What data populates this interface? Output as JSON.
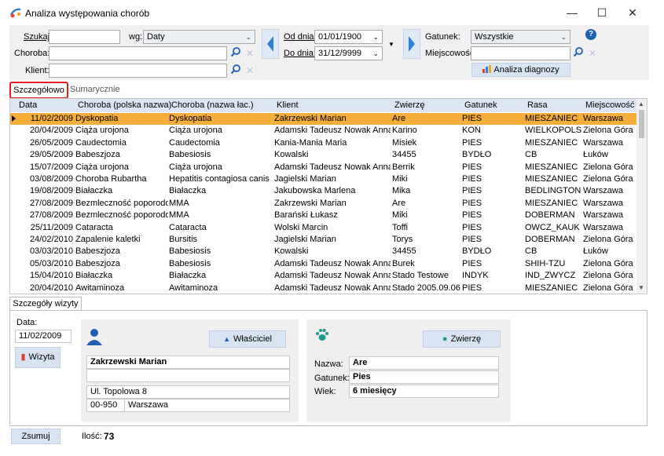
{
  "window": {
    "title": "Analiza występowania chorób",
    "minimize": "—",
    "maximize": "☐",
    "close": "✕"
  },
  "filters": {
    "szukaj_label": "Szukaj:",
    "szukaj_value": "",
    "wg_label": "wg:",
    "wg_value": "Daty",
    "choroba_label": "Choroba:",
    "klient_label": "Klient:",
    "od_label": "Od dnia:",
    "od_value": "01/01/1900",
    "do_label": "Do dnia:",
    "do_value": "31/12/9999",
    "gatunek_label": "Gatunek:",
    "gatunek_value": "Wszystkie",
    "miejscowosc_label": "Miejscowość:",
    "analiza_button": "Analiza diagnozy",
    "help": "?"
  },
  "tabs": {
    "active": "Szczegółowo",
    "inactive": "Sumarycznie"
  },
  "table": {
    "columns": [
      "Data",
      "Choroba (polska nazwa)",
      "Choroba (nazwa łac.)",
      "Klient",
      "Zwierzę",
      "Gatunek",
      "Rasa",
      "Miejscowość"
    ],
    "rows": [
      [
        "11/02/2009",
        "Dyskopatia",
        "Dyskopatia",
        "Zakrzewski Marian",
        "Are",
        "PIES",
        "MIESZANIEC",
        "Warszawa"
      ],
      [
        "20/04/2009",
        "Ciąża urojona",
        "Ciąża urojona",
        "Adamski Tadeusz Nowak Anna",
        "Karino",
        "KOŃ",
        "WIELKOPOLS",
        "Zielona Góra"
      ],
      [
        "26/05/2009",
        "Caudectomia",
        "Caudectomia",
        "Kania-Mania Maria",
        "Misiek",
        "PIES",
        "MIESZANIEC",
        "Warszawa"
      ],
      [
        "29/05/2009",
        "Babeszjoza",
        "Babesiosis",
        "Kowalski",
        "34455",
        "BYDŁO",
        "CB",
        "Łuków"
      ],
      [
        "15/07/2009",
        "Ciąża urojona",
        "Ciąża urojona",
        "Adamski Tadeusz Nowak Anna",
        "Berrik",
        "PIES",
        "MIESZANIEC",
        "Zielona Góra"
      ],
      [
        "03/08/2009",
        "Choroba Rubartha",
        "Hepatitis contagiosa canis",
        "Jagielski Marian",
        "Miki",
        "PIES",
        "MIESZANIEC",
        "Zielona Góra"
      ],
      [
        "19/08/2009",
        "Białaczka",
        "Białaczka",
        "Jakubowska Marlena",
        "Mika",
        "PIES",
        "BEDLINGTON",
        "Warszawa"
      ],
      [
        "27/08/2009",
        "Bezmleczność poporodow",
        "MMA",
        "Zakrzewski Marian",
        "Are",
        "PIES",
        "MIESZANIEC",
        "Warszawa"
      ],
      [
        "27/08/2009",
        "Bezmleczność poporodow",
        "MMA",
        "Barański Łukasz",
        "Miki",
        "PIES",
        "DOBERMAN",
        "Warszawa"
      ],
      [
        "25/11/2009",
        "Cataracta",
        "Cataracta",
        "Wolski Marcin",
        "Toffi",
        "PIES",
        "OWCZ_KAUK",
        "Warszawa"
      ],
      [
        "24/02/2010",
        "Zapalenie kaletki",
        "Bursitis",
        "Jagielski Marian",
        "Torys",
        "PIES",
        "DOBERMAN",
        "Zielona Góra"
      ],
      [
        "03/03/2010",
        "Babeszjoza",
        "Babesiosis",
        "Kowalski",
        "34455",
        "BYDŁO",
        "CB",
        "Łuków"
      ],
      [
        "05/03/2010",
        "Babeszjoza",
        "Babesiosis",
        "Adamski Tadeusz Nowak Anna",
        "Burek",
        "PIES",
        "SHIH-TZU",
        "Zielona Góra"
      ],
      [
        "15/04/2010",
        "Białaczka",
        "Białaczka",
        "Adamski Tadeusz Nowak Anna",
        "Stado Testowe",
        "INDYK",
        "IND_ZWYCZ",
        "Zielona Góra"
      ],
      [
        "20/04/2010",
        "Awitaminoza",
        "Awitaminoza",
        "Adamski Tadeusz Nowak Anna",
        "Stado 2005.09.06",
        "PIES",
        "MIESZANIEC",
        "Zielona Góra"
      ]
    ]
  },
  "details": {
    "tab_label": "Szczegóły wizyty",
    "data_label": "Data:",
    "data_value": "11/02/2009",
    "wizyta_button": "Wizyta",
    "wlasciciel_button": "Właściciel",
    "owner_name": "Zakrzewski Marian",
    "owner_line2": "",
    "owner_street": "Ul. Topolowa 8",
    "owner_zip": "00-950",
    "owner_city": "Warszawa",
    "zwierze_button": "Zwierzę",
    "nazwa_label": "Nazwa:",
    "nazwa_value": "Are",
    "gatunek_label": "Gatunek:",
    "gatunek_value": "Pies",
    "wiek_label": "Wiek:",
    "wiek_value": "6 miesięcy"
  },
  "footer": {
    "zsumuj_button": "Zsumuj",
    "ilosc_label": "Ilość:",
    "ilosc_value": "73"
  },
  "colors": {
    "selected_row": "#f5ad3c",
    "header": "#dce6f2",
    "accent_blue": "#1e5fb4",
    "tab_highlight": "#e02020"
  }
}
